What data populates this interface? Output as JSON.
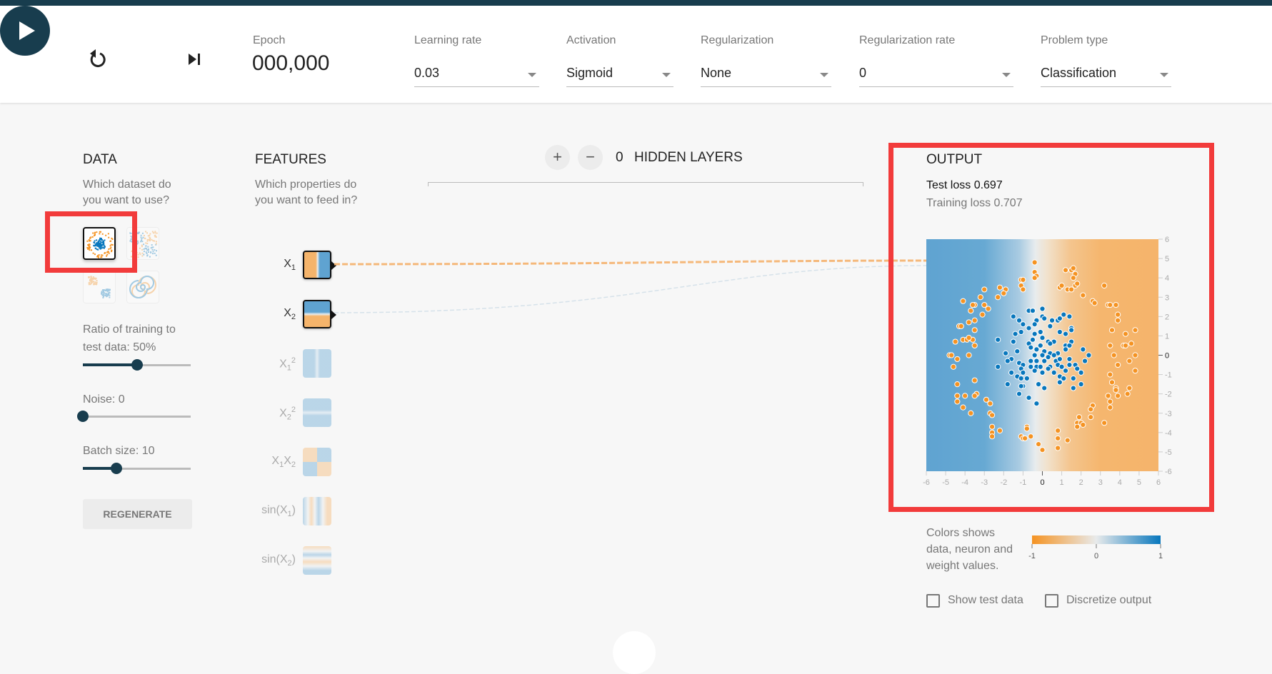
{
  "header": {
    "reset_icon": "reset-icon",
    "play_icon": "play-icon",
    "step_icon": "step-forward-icon",
    "epoch_label": "Epoch",
    "epoch_value": "000,000",
    "controls": [
      {
        "label": "Learning rate",
        "value": "0.03"
      },
      {
        "label": "Activation",
        "value": "Sigmoid"
      },
      {
        "label": "Regularization",
        "value": "None"
      },
      {
        "label": "Regularization rate",
        "value": "0"
      },
      {
        "label": "Problem type",
        "value": "Classification"
      }
    ]
  },
  "data_panel": {
    "title": "DATA",
    "subtitle_line1": "Which dataset do",
    "subtitle_line2": "you want to use?",
    "datasets": [
      {
        "name": "circle",
        "selected": true
      },
      {
        "name": "exclusive-or",
        "selected": false
      },
      {
        "name": "gaussian",
        "selected": false
      },
      {
        "name": "spiral",
        "selected": false
      }
    ],
    "ratio_label_line1": "Ratio of training to",
    "ratio_label_line2": "test data:  50%",
    "ratio_value_percent": 50,
    "noise_label": "Noise:  0",
    "noise_value": 0,
    "noise_max": 50,
    "batch_label": "Batch size:  10",
    "batch_value": 10,
    "batch_min": 1,
    "batch_max": 30,
    "regenerate_label": "REGENERATE"
  },
  "features_panel": {
    "title": "FEATURES",
    "subtitle_line1": "Which properties do",
    "subtitle_line2": "you want to feed in?",
    "features": [
      {
        "id": "x1",
        "base": "X",
        "sub": "1",
        "sup": "",
        "active": true
      },
      {
        "id": "x2",
        "base": "X",
        "sub": "2",
        "sup": "",
        "active": true
      },
      {
        "id": "x1sq",
        "base": "X",
        "sub": "1",
        "sup": "2",
        "active": false
      },
      {
        "id": "x2sq",
        "base": "X",
        "sub": "2",
        "sup": "2",
        "active": false
      },
      {
        "id": "x1x2",
        "base": "X1X2",
        "sub": "",
        "sup": "",
        "active": false
      },
      {
        "id": "sinx1",
        "base": "sin(X",
        "sub": "1",
        "sup": "",
        "active": false
      },
      {
        "id": "sinx2",
        "base": "sin(X",
        "sub": "2",
        "sup": "",
        "active": false
      }
    ]
  },
  "network": {
    "add_layer_icon": "plus-icon",
    "remove_layer_icon": "minus-icon",
    "hidden_layers_count": "0",
    "hidden_layers_label": "HIDDEN LAYERS"
  },
  "output_panel": {
    "title": "OUTPUT",
    "test_loss": "Test loss 0.697",
    "training_loss": "Training loss 0.707",
    "legend_text_line1": "Colors shows",
    "legend_text_line2": "data, neuron and",
    "legend_text_line3": "weight values.",
    "legend_ticks": [
      "-1",
      "0",
      "1"
    ],
    "show_test_data_label": "Show test data",
    "show_test_data_checked": false,
    "discretize_label": "Discretize output",
    "discretize_checked": false
  },
  "colors": {
    "accent": "#183d4e",
    "orange": "#f59322",
    "blue": "#0877bd",
    "highlight": "#f23b3b"
  },
  "chart_data": {
    "type": "scatter",
    "title": "",
    "xlabel": "",
    "ylabel": "",
    "xlim": [
      -6,
      6
    ],
    "ylim": [
      -6,
      6
    ],
    "x_ticks": [
      "-6",
      "-5",
      "-4",
      "-3",
      "-2",
      "-1",
      "0",
      "1",
      "2",
      "3",
      "4",
      "5",
      "6"
    ],
    "y_ticks": [
      "6",
      "5",
      "4",
      "3",
      "2",
      "1",
      "0",
      "-1",
      "-2",
      "-3",
      "-4",
      "-5",
      "-6"
    ],
    "background": "decision boundary: blue (left, x<0) to orange (right, x>0), boundary near x≈0",
    "series": [
      {
        "name": "class 1 (inner, blue)",
        "color": "#0877bd",
        "points": [
          [
            0.0,
            2.4
          ],
          [
            -0.7,
            2.3
          ],
          [
            -0.5,
            2.3
          ],
          [
            -1.5,
            2.0
          ],
          [
            0.0,
            2.0
          ],
          [
            0.1,
            1.9
          ],
          [
            -0.3,
            1.8
          ],
          [
            0.5,
            1.8
          ],
          [
            0.8,
            1.8
          ],
          [
            0.9,
            1.9
          ],
          [
            1.1,
            2.1
          ],
          [
            1.4,
            2.0
          ],
          [
            -1.2,
            1.8
          ],
          [
            -1.0,
            1.6
          ],
          [
            -0.4,
            1.6
          ],
          [
            -0.7,
            1.4
          ],
          [
            0.4,
            1.5
          ],
          [
            1.5,
            1.4
          ],
          [
            1.5,
            1.3
          ],
          [
            -1.4,
            1.1
          ],
          [
            -1.1,
            1.2
          ],
          [
            -0.4,
            1.1
          ],
          [
            -0.1,
            1.2
          ],
          [
            0.9,
            1.2
          ],
          [
            1.2,
            1.1
          ],
          [
            -2.3,
            0.8
          ],
          [
            -1.5,
            0.7
          ],
          [
            -0.7,
            0.6
          ],
          [
            -0.5,
            0.8
          ],
          [
            0.0,
            0.9
          ],
          [
            0.3,
            0.7
          ],
          [
            0.6,
            0.7
          ],
          [
            1.5,
            0.7
          ],
          [
            -0.6,
            0.4
          ],
          [
            -0.1,
            0.5
          ],
          [
            0.4,
            0.6
          ],
          [
            1.2,
            0.5
          ],
          [
            1.4,
            0.5
          ],
          [
            -1.9,
            0.1
          ],
          [
            -1.3,
            0.2
          ],
          [
            -0.3,
            0.3
          ],
          [
            0.1,
            0.2
          ],
          [
            0.4,
            0.1
          ],
          [
            0.8,
            0.1
          ],
          [
            1.2,
            0.3
          ],
          [
            2.1,
            0.3
          ],
          [
            2.4,
            0.0
          ],
          [
            -0.4,
            0.0
          ],
          [
            0.0,
            0.0
          ],
          [
            0.3,
            -0.1
          ],
          [
            0.6,
            0.0
          ],
          [
            -1.6,
            -0.2
          ],
          [
            -1.2,
            -0.4
          ],
          [
            -0.6,
            -0.3
          ],
          [
            -0.3,
            -0.3
          ],
          [
            0.1,
            -0.3
          ],
          [
            0.7,
            -0.3
          ],
          [
            0.9,
            -0.2
          ],
          [
            1.4,
            -0.2
          ],
          [
            2.2,
            -0.3
          ],
          [
            -1.8,
            -0.3
          ],
          [
            -1.0,
            -0.5
          ],
          [
            -0.3,
            -0.6
          ],
          [
            0.4,
            -0.6
          ],
          [
            0.8,
            -0.5
          ],
          [
            1.4,
            -0.5
          ],
          [
            1.7,
            -0.5
          ],
          [
            -2.3,
            -0.6
          ],
          [
            -1.1,
            -0.7
          ],
          [
            -0.6,
            -0.6
          ],
          [
            -0.1,
            -0.6
          ],
          [
            0.3,
            -0.7
          ],
          [
            1.0,
            -0.6
          ],
          [
            1.8,
            -0.7
          ],
          [
            -1.6,
            -0.9
          ],
          [
            -1.0,
            -0.9
          ],
          [
            -0.4,
            -0.8
          ],
          [
            0.0,
            -0.9
          ],
          [
            0.6,
            -0.9
          ],
          [
            1.2,
            -0.8
          ],
          [
            2.0,
            -0.9
          ],
          [
            -1.3,
            -1.1
          ],
          [
            -1.1,
            -1.2
          ],
          [
            -0.8,
            -1.2
          ],
          [
            0.9,
            -1.1
          ],
          [
            1.1,
            -1.2
          ],
          [
            1.6,
            -1.2
          ],
          [
            -1.8,
            -1.5
          ],
          [
            -1.0,
            -1.6
          ],
          [
            -1.1,
            -1.6
          ],
          [
            -0.2,
            -1.5
          ],
          [
            0.1,
            -1.7
          ],
          [
            1.6,
            -1.7
          ],
          [
            2.0,
            -1.5
          ],
          [
            -1.2,
            -2.0
          ],
          [
            -0.7,
            -2.2
          ],
          [
            -0.3,
            -2.5
          ],
          [
            0.9,
            -1.4
          ]
        ]
      },
      {
        "name": "class -1 (outer ring, orange)",
        "color": "#f59322",
        "points": [
          [
            -0.4,
            4.8
          ],
          [
            -0.4,
            4.3
          ],
          [
            -0.3,
            4.1
          ],
          [
            -0.4,
            4.0
          ],
          [
            -1.1,
            3.9
          ],
          [
            -1.0,
            3.9
          ],
          [
            -1.1,
            3.6
          ],
          [
            -1.0,
            3.4
          ],
          [
            1.2,
            4.4
          ],
          [
            1.5,
            4.4
          ],
          [
            1.6,
            4.5
          ],
          [
            1.7,
            4.2
          ],
          [
            1.6,
            4.0
          ],
          [
            1.7,
            3.6
          ],
          [
            1.8,
            3.7
          ],
          [
            0.9,
            3.5
          ],
          [
            1.0,
            3.6
          ],
          [
            1.3,
            3.4
          ],
          [
            1.5,
            3.4
          ],
          [
            2.1,
            3.1
          ],
          [
            3.2,
            3.6
          ],
          [
            -3.0,
            3.4
          ],
          [
            -2.2,
            3.5
          ],
          [
            -1.9,
            3.4
          ],
          [
            -2.0,
            3.2
          ],
          [
            -2.3,
            3.0
          ],
          [
            -3.2,
            3.0
          ],
          [
            -4.1,
            2.8
          ],
          [
            -3.0,
            2.6
          ],
          [
            -3.5,
            2.6
          ],
          [
            -3.6,
            2.6
          ],
          [
            -2.8,
            2.4
          ],
          [
            -3.7,
            2.3
          ],
          [
            -3.1,
            2.1
          ],
          [
            2.6,
            2.8
          ],
          [
            2.7,
            2.7
          ],
          [
            3.4,
            2.6
          ],
          [
            3.5,
            2.6
          ],
          [
            3.8,
            2.6
          ],
          [
            3.9,
            2.1
          ],
          [
            3.9,
            1.8
          ],
          [
            -3.5,
            1.8
          ],
          [
            -3.8,
            1.7
          ],
          [
            -4.3,
            1.5
          ],
          [
            -4.2,
            1.5
          ],
          [
            -3.5,
            1.3
          ],
          [
            3.6,
            1.3
          ],
          [
            4.3,
            1.1
          ],
          [
            4.8,
            1.3
          ],
          [
            -4.5,
            0.7
          ],
          [
            -4.1,
            0.8
          ],
          [
            -3.9,
            0.8
          ],
          [
            -3.6,
            0.8
          ],
          [
            -3.5,
            0.5
          ],
          [
            -3.8,
            0.9
          ],
          [
            3.5,
            0.5
          ],
          [
            4.2,
            0.5
          ],
          [
            4.3,
            0.5
          ],
          [
            4.6,
            0.6
          ],
          [
            -4.8,
            0.0
          ],
          [
            -4.7,
            0.0
          ],
          [
            -3.8,
            0.0
          ],
          [
            -4.4,
            -0.2
          ],
          [
            3.7,
            0.0
          ],
          [
            4.8,
            0.0
          ],
          [
            4.5,
            -0.3
          ],
          [
            -4.6,
            -0.6
          ],
          [
            3.9,
            -0.5
          ],
          [
            4.8,
            -0.8
          ],
          [
            3.5,
            -1.0
          ],
          [
            -3.5,
            -1.3
          ],
          [
            -4.4,
            -1.5
          ],
          [
            3.6,
            -1.4
          ],
          [
            3.8,
            -1.7
          ],
          [
            3.8,
            -1.8
          ],
          [
            4.5,
            -1.7
          ],
          [
            -3.4,
            -2.0
          ],
          [
            -4.4,
            -2.1
          ],
          [
            -4.0,
            -2.1
          ],
          [
            -3.5,
            -2.1
          ],
          [
            3.4,
            -2.1
          ],
          [
            3.9,
            -2.1
          ],
          [
            4.4,
            -2.0
          ],
          [
            -4.4,
            -2.4
          ],
          [
            -2.9,
            -2.3
          ],
          [
            -2.7,
            -2.5
          ],
          [
            3.5,
            -2.4
          ],
          [
            -4.1,
            -2.7
          ],
          [
            3.5,
            -2.7
          ],
          [
            2.6,
            -2.6
          ],
          [
            2.5,
            -2.8
          ],
          [
            -3.7,
            -3.0
          ],
          [
            -2.7,
            -3.0
          ],
          [
            -2.6,
            -3.1
          ],
          [
            2.5,
            -3.2
          ],
          [
            1.9,
            -3.2
          ],
          [
            1.8,
            -3.5
          ],
          [
            2.0,
            -3.5
          ],
          [
            3.2,
            -3.5
          ],
          [
            1.8,
            -3.7
          ],
          [
            2.1,
            -3.6
          ],
          [
            -2.6,
            -3.7
          ],
          [
            -2.6,
            -4.0
          ],
          [
            -2.2,
            -3.9
          ],
          [
            -0.8,
            -3.7
          ],
          [
            -0.8,
            -3.8
          ],
          [
            0.8,
            -3.9
          ],
          [
            -2.6,
            -4.2
          ],
          [
            -1.1,
            -4.2
          ],
          [
            -1.0,
            -4.3
          ],
          [
            -0.9,
            -4.3
          ],
          [
            -0.6,
            -4.2
          ],
          [
            0.8,
            -4.3
          ],
          [
            1.3,
            -4.4
          ],
          [
            -0.2,
            -4.6
          ],
          [
            0.8,
            -4.8
          ],
          [
            0.0,
            -4.9
          ]
        ]
      }
    ]
  }
}
